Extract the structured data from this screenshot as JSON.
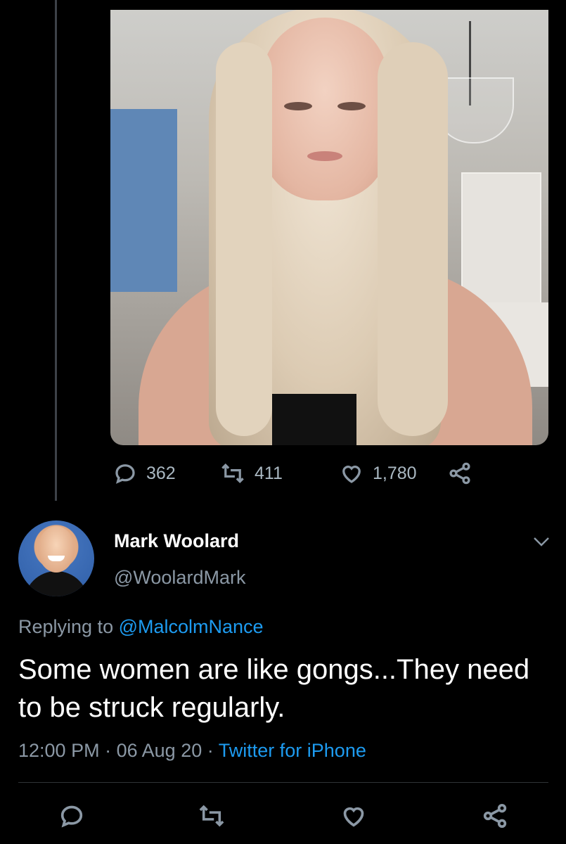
{
  "parent_tweet": {
    "stats": {
      "replies": "362",
      "retweets": "411",
      "likes": "1,780"
    },
    "media": {
      "kind": "video-still"
    }
  },
  "tweet": {
    "author_name": "Mark Woolard",
    "author_handle": "@WoolardMark",
    "replying_prefix": "Replying to",
    "replying_to": "@MalcolmNance",
    "text": "Some women are like gongs...They need to be struck regularly.",
    "time": "12:00 PM",
    "separator": "·",
    "date": "06 Aug 20",
    "source": "Twitter for iPhone"
  },
  "icons": {
    "reply": "reply-icon",
    "retweet": "retweet-icon",
    "like": "heart-icon",
    "share": "share-icon",
    "more": "chevron-down-icon"
  },
  "colors": {
    "background": "#000000",
    "link": "#1d9bf0",
    "muted": "#8b98a5"
  }
}
